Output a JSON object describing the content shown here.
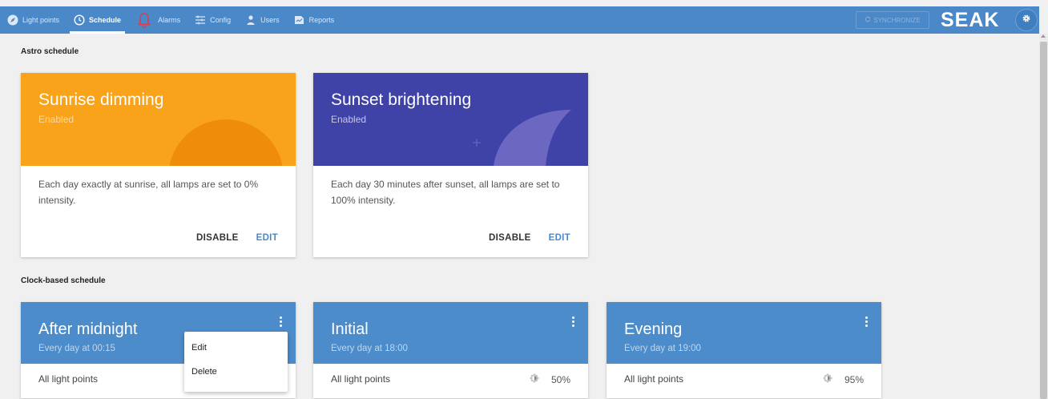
{
  "nav": {
    "items": [
      {
        "label": "Light points",
        "icon": "compass-icon"
      },
      {
        "label": "Schedule",
        "icon": "clock-icon"
      },
      {
        "label": "Alarms",
        "icon": "bell-icon"
      },
      {
        "label": "Config",
        "icon": "sliders-icon"
      },
      {
        "label": "Users",
        "icon": "user-icon"
      },
      {
        "label": "Reports",
        "icon": "report-icon"
      }
    ],
    "active": "Schedule",
    "sync_label": "SYNCHRONIZE",
    "logo": "SEAK"
  },
  "colors": {
    "topbar": "#4a88c8",
    "sunrise": "#f9a31a",
    "sunset": "#3f43a8",
    "clock_header": "#4d8cca",
    "alarm_icon": "#e0394a",
    "edit_link": "#4a88c8"
  },
  "astro": {
    "title": "Astro schedule",
    "cards": [
      {
        "title": "Sunrise dimming",
        "status": "Enabled",
        "description": "Each day exactly at sunrise, all lamps are set to 0% intensity.",
        "disable_label": "DISABLE",
        "edit_label": "EDIT"
      },
      {
        "title": "Sunset brightening",
        "status": "Enabled",
        "description": "Each day 30 minutes after sunset, all lamps are set to 100% intensity.",
        "disable_label": "DISABLE",
        "edit_label": "EDIT"
      }
    ]
  },
  "clock": {
    "title": "Clock-based schedule",
    "cards": [
      {
        "title": "After midnight",
        "subtitle": "Every day at 00:15",
        "target": "All light points",
        "level": ""
      },
      {
        "title": "Initial",
        "subtitle": "Every day at 18:00",
        "target": "All light points",
        "level": "50%"
      },
      {
        "title": "Evening",
        "subtitle": "Every day at 19:00",
        "target": "All light points",
        "level": "95%"
      }
    ]
  },
  "context_menu": {
    "items": [
      "Edit",
      "Delete"
    ]
  }
}
